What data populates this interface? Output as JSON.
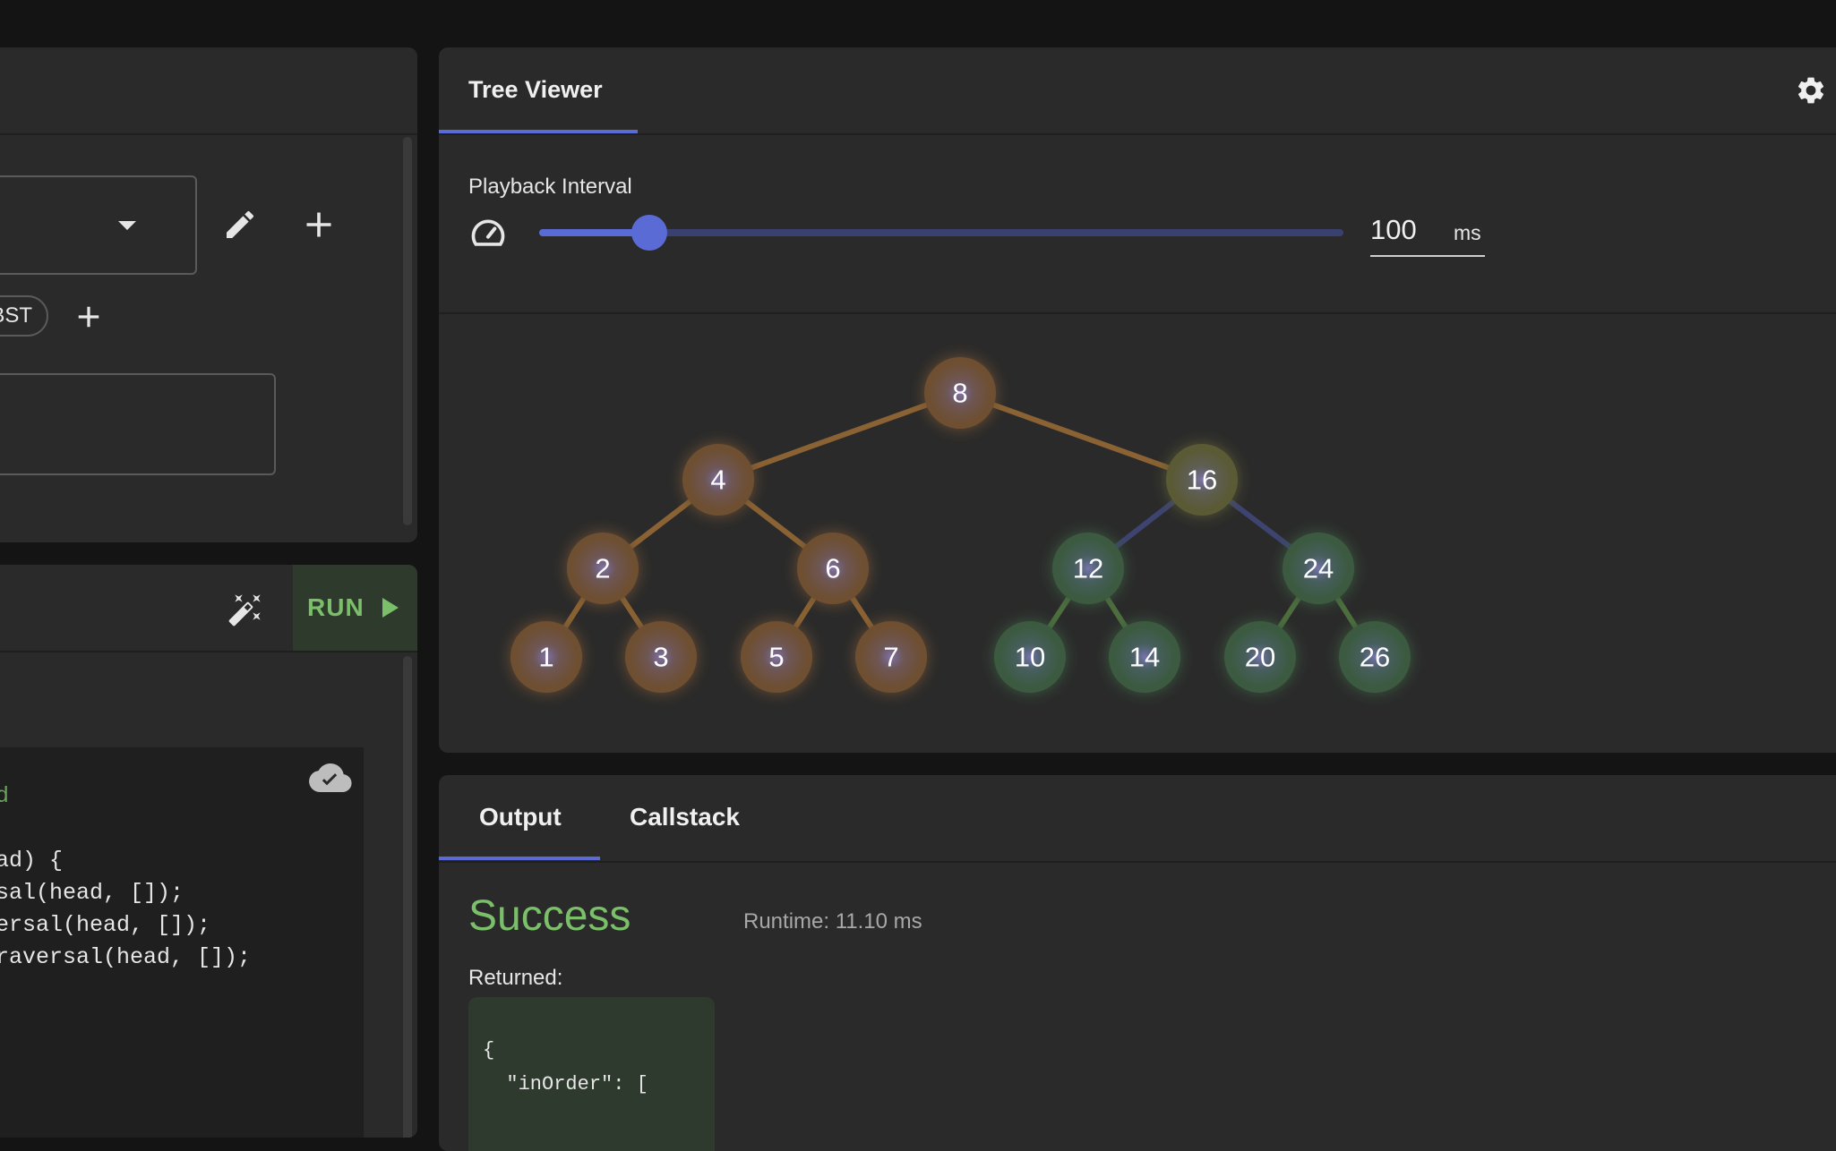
{
  "editor": {
    "chip_label": "BST",
    "run_label": "RUN",
    "code_lines": [
      "ad",
      "",
      "ead) {",
      "rsal(head, []);",
      "versal(head, []);",
      "Traversal(head, []);"
    ]
  },
  "tree_viewer": {
    "title": "Tree Viewer",
    "playback_label": "Playback Interval",
    "interval_value": "100",
    "interval_unit": "ms",
    "slider_fraction": 0.137,
    "nodes": [
      {
        "label": "8",
        "group": "orange"
      },
      {
        "label": "4",
        "group": "orange"
      },
      {
        "label": "16",
        "group": "olive"
      },
      {
        "label": "2",
        "group": "orange"
      },
      {
        "label": "6",
        "group": "orange"
      },
      {
        "label": "12",
        "group": "green"
      },
      {
        "label": "24",
        "group": "green"
      },
      {
        "label": "1",
        "group": "orange"
      },
      {
        "label": "3",
        "group": "orange"
      },
      {
        "label": "5",
        "group": "orange"
      },
      {
        "label": "7",
        "group": "orange"
      },
      {
        "label": "10",
        "group": "green"
      },
      {
        "label": "14",
        "group": "green"
      },
      {
        "label": "20",
        "group": "green"
      },
      {
        "label": "26",
        "group": "green"
      }
    ],
    "colors": {
      "orange": "#6e4f33",
      "olive": "#5a5a35",
      "green": "#3b5a3f",
      "edge_orange": "#8a6233",
      "edge_blue": "#3d4470",
      "edge_green": "#4d6e3d",
      "accent": "#5b6bd6"
    }
  },
  "output": {
    "tabs": [
      "Output",
      "Callstack"
    ],
    "active_tab": "Output",
    "status": "Success",
    "runtime": "Runtime: 11.10 ms",
    "returned_label": "Returned:",
    "json_lines": [
      "{",
      "  \"inOrder\": ["
    ]
  }
}
